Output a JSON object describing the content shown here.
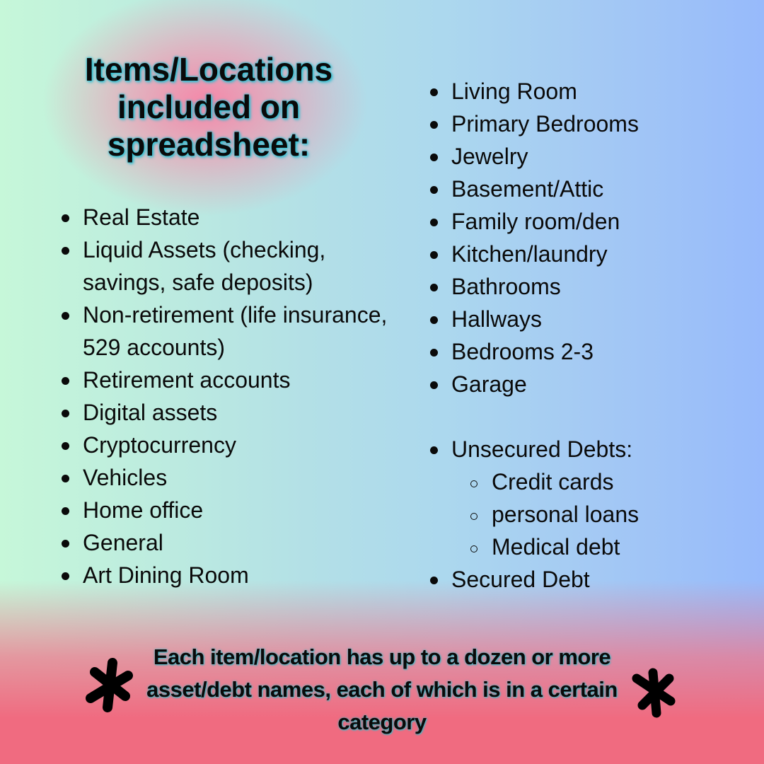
{
  "title": "Items/Locations included on spreadsheet:",
  "left_list": [
    "Real Estate",
    "Liquid Assets (checking, savings, safe deposits)",
    "Non-retirement (life insurance, 529 accounts)",
    "Retirement accounts",
    "Digital assets",
    "Cryptocurrency",
    "Vehicles",
    "Home office",
    "General",
    "Art Dining Room"
  ],
  "right_list": {
    "locations": [
      "Living Room",
      "Primary Bedrooms",
      "Jewelry",
      "Basement/Attic",
      "Family room/den",
      "Kitchen/laundry",
      "Bathrooms",
      "Hallways",
      "Bedrooms 2-3",
      "Garage"
    ],
    "unsecured_debts": {
      "label": "Unsecured Debts:",
      "sub_items": [
        "Credit cards",
        "personal loans",
        "Medical debt"
      ]
    },
    "secured_debt": "Secured Debt"
  },
  "footer_note": "Each item/location has up to a dozen or more asset/debt names, each of which is in a certain category",
  "icons": {
    "left_decoration": "asterisk-icon",
    "right_decoration": "asterisk-icon"
  },
  "colors": {
    "top_left_mint": "#c6f7d9",
    "title_glow_pink": "#f882a5",
    "middle_light_blue": "#acd8ee",
    "right_periwinkle": "#97bafb",
    "bottom_coral": "#f06b80",
    "text_shadow_cyan": "#2fc4d6",
    "text": "#0a0a0a"
  }
}
